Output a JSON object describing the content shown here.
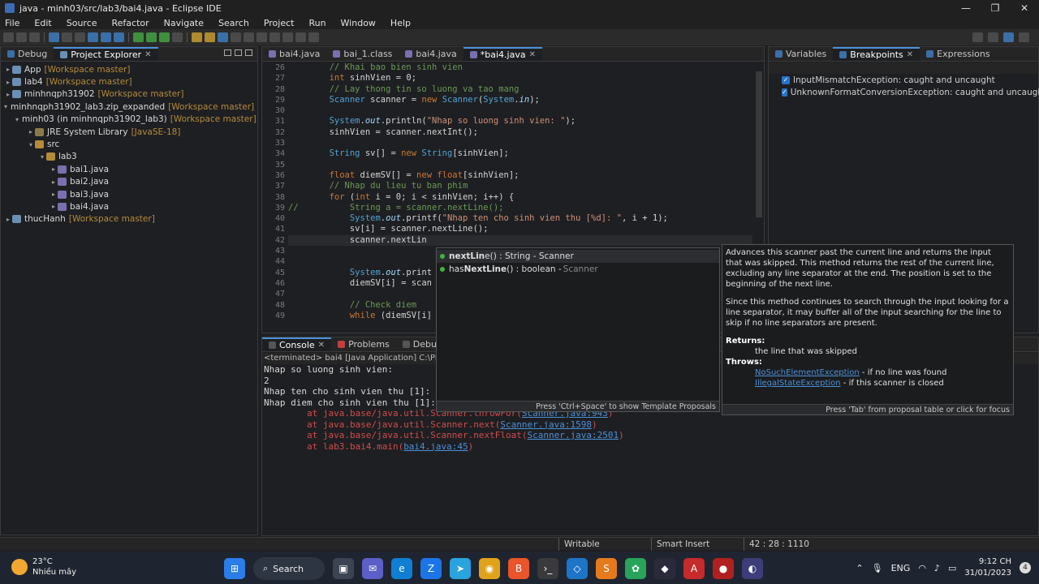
{
  "window": {
    "title": "java - minh03/src/lab3/bai4.java - Eclipse IDE"
  },
  "menu": [
    "File",
    "Edit",
    "Source",
    "Refactor",
    "Navigate",
    "Search",
    "Project",
    "Run",
    "Window",
    "Help"
  ],
  "left_tabs": {
    "debug": "Debug",
    "explorer": "Project Explorer"
  },
  "tree": [
    {
      "indent": 0,
      "arrow": ">",
      "name": "App",
      "suffix": "[Workspace master]",
      "icon": "#6a8fb3"
    },
    {
      "indent": 0,
      "arrow": ">",
      "name": "lab4",
      "suffix": "[Workspace master]",
      "icon": "#6a8fb3"
    },
    {
      "indent": 0,
      "arrow": ">",
      "name": "minhnqph31902",
      "suffix": "[Workspace master]",
      "icon": "#6a8fb3"
    },
    {
      "indent": 0,
      "arrow": "v",
      "name": "minhnqph31902_lab3.zip_expanded",
      "suffix": "[Workspace master]",
      "icon": "#6a8fb3"
    },
    {
      "indent": 1,
      "arrow": "v",
      "name": "minh03 (in minhnqph31902_lab3)",
      "suffix": "[Workspace master]",
      "icon": "#6a8fb3"
    },
    {
      "indent": 2,
      "arrow": ">",
      "name": "JRE System Library",
      "suffix": "[JavaSE-18]",
      "icon": "#8a7a4a"
    },
    {
      "indent": 2,
      "arrow": "v",
      "name": "src",
      "suffix": "",
      "icon": "#b58b3a"
    },
    {
      "indent": 3,
      "arrow": "v",
      "name": "lab3",
      "suffix": "",
      "icon": "#b58b3a"
    },
    {
      "indent": 4,
      "arrow": ">",
      "name": "bai1.java",
      "suffix": "",
      "icon": "#7b6fb0"
    },
    {
      "indent": 4,
      "arrow": ">",
      "name": "bai2.java",
      "suffix": "",
      "icon": "#7b6fb0"
    },
    {
      "indent": 4,
      "arrow": ">",
      "name": "bai3.java",
      "suffix": "",
      "icon": "#7b6fb0"
    },
    {
      "indent": 4,
      "arrow": ">",
      "name": "bai4.java",
      "suffix": "",
      "icon": "#7b6fb0"
    },
    {
      "indent": 0,
      "arrow": ">",
      "name": "thucHanh",
      "suffix": "[Workspace master]",
      "icon": "#6a8fb3"
    }
  ],
  "editor_tabs": [
    {
      "label": "bai4.java",
      "active": false
    },
    {
      "label": "bai_1.class",
      "active": false
    },
    {
      "label": "bai4.java",
      "active": false
    },
    {
      "label": "*bai4.java",
      "active": true
    }
  ],
  "code_lines": [
    {
      "n": "26",
      "html": "        <span class='cm'>// Khai bao bien sinh vien</span>"
    },
    {
      "n": "27",
      "html": "        <span class='kw'>int</span> sinhVien = 0;"
    },
    {
      "n": "28",
      "html": "        <span class='cm'>// Lay thong tin so luong va tao mang</span>"
    },
    {
      "n": "29",
      "html": "        <span class='ty'>Scanner</span> scanner = <span class='kw'>new</span> <span class='ty'>Scanner</span>(<span class='ty'>System</span>.<span class='fd'>in</span>);"
    },
    {
      "n": "30",
      "html": ""
    },
    {
      "n": "31",
      "html": "        <span class='ty'>System</span>.<span class='fd'>out</span>.println(<span class='st'>\"Nhap so luong sinh vien: \"</span>);"
    },
    {
      "n": "32",
      "html": "        sinhVien = scanner.nextInt();"
    },
    {
      "n": "33",
      "html": ""
    },
    {
      "n": "34",
      "html": "        <span class='ty'>String</span> sv[] = <span class='kw'>new</span> <span class='ty'>String</span>[sinhVien];"
    },
    {
      "n": "35",
      "html": ""
    },
    {
      "n": "36",
      "html": "        <span class='kw'>float</span> diemSV[] = <span class='kw'>new</span> <span class='kw'>float</span>[sinhVien];"
    },
    {
      "n": "37",
      "html": "        <span class='cm'>// Nhap du lieu tu ban phim</span>"
    },
    {
      "n": "38",
      "html": "        <span class='kw'>for</span> (<span class='kw'>int</span> i = 0; i &lt; sinhVien; i++) {"
    },
    {
      "n": "39",
      "html": "<span class='cm'>//          String a = scanner.nextLine();</span>"
    },
    {
      "n": "40",
      "html": "            <span class='ty'>System</span>.<span class='fd'>out</span>.printf(<span class='st'>\"Nhap ten cho sinh vien thu [%d]: \"</span>, i + 1);"
    },
    {
      "n": "41",
      "html": "            sv[i] = scanner.nextLine();"
    },
    {
      "n": "42",
      "html": "            scanner.nextLin",
      "current": true
    },
    {
      "n": "43",
      "html": ""
    },
    {
      "n": "44",
      "html": ""
    },
    {
      "n": "45",
      "html": "            <span class='ty'>System</span>.<span class='fd'>out</span>.print"
    },
    {
      "n": "46",
      "html": "            diemSV[i] = scan"
    },
    {
      "n": "47",
      "html": ""
    },
    {
      "n": "48",
      "html": "            <span class='cm'>// Check diem</span>"
    },
    {
      "n": "49",
      "html": "            <span class='kw'>while</span> (diemSV[i]"
    }
  ],
  "proposals": [
    {
      "bold": "nextLin",
      "rest": "e() : String - Scanner",
      "muted": "",
      "selected": true
    },
    {
      "bold_pre": "has",
      "bold": "NextLine",
      "rest": "() : boolean - ",
      "muted": "Scanner",
      "selected": false
    }
  ],
  "proposal_footer": "Press 'Ctrl+Space' to show Template Proposals",
  "doc": {
    "p1": "Advances this scanner past the current line and returns the input that was skipped. This method returns the rest of the current line, excluding any line separator at the end. The position is set to the beginning of the next line.",
    "p2": "Since this method continues to search through the input looking for a line separator, it may buffer all of the input searching for the line to skip if no line separators are present.",
    "returns_label": "Returns:",
    "returns_text": "the line that was skipped",
    "throws_label": "Throws:",
    "throws": [
      {
        "ex": "NoSuchElementException",
        "desc": " - if no line was found"
      },
      {
        "ex": "IllegalStateException",
        "desc": " - if this scanner is closed"
      }
    ],
    "footer": "Press 'Tab' from proposal table or click for focus"
  },
  "right_tabs": {
    "variables": "Variables",
    "breakpoints": "Breakpoints",
    "expressions": "Expressions"
  },
  "breakpoints": [
    "InputMismatchException: caught and uncaught",
    "UnknownFormatConversionException: caught and uncaught"
  ],
  "console_tabs": {
    "console": "Console",
    "problems": "Problems",
    "debug_shell": "Debug Shell"
  },
  "console": {
    "terminated": "<terminated> bai4 [Java Application] C:\\Progran",
    "lines": [
      "Nhap so luong sinh vien:",
      "2",
      "Nhap ten cho sinh vien thu [1]:",
      "Nhap diem cho sinh vien thu [1]:"
    ],
    "errors": [
      {
        "pre": "        at java.base/java.util.Scanner.throwFor(",
        "link": "Scanner.java:943",
        "post": ")"
      },
      {
        "pre": "        at java.base/java.util.Scanner.next(",
        "link": "Scanner.java:1598",
        "post": ")"
      },
      {
        "pre": "        at java.base/java.util.Scanner.nextFloat(",
        "link": "Scanner.java:2501",
        "post": ")"
      },
      {
        "pre": "        at lab3.bai4.main(",
        "link": "bai4.java:45",
        "post": ")"
      }
    ]
  },
  "status": {
    "writable": "Writable",
    "insert": "Smart Insert",
    "position": "42 : 28 : 1110"
  },
  "taskbar": {
    "temp": "23°C",
    "weather": "Nhiều mây",
    "search": "Search",
    "lang": "ENG",
    "time": "9:12 CH",
    "date": "31/01/2023",
    "notifications": "4"
  },
  "colors": {
    "accent": "#4a90d9",
    "error": "#d24b4b",
    "comment": "#6a9955",
    "keyword": "#cc7832"
  }
}
